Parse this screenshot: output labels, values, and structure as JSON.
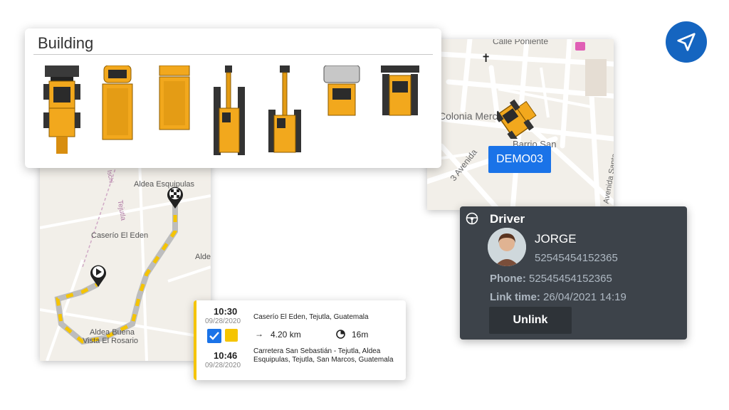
{
  "building_panel": {
    "title": "Building",
    "vehicles": [
      "loader-icon",
      "dump-truck-icon",
      "tipper-truck-icon",
      "excavator-icon",
      "crane-excavator-icon",
      "road-roller-icon",
      "bulldozer-icon"
    ]
  },
  "map_top": {
    "street_top": "Calle Poniente",
    "colonia": "Colonia Merce",
    "street_avenida": "3 Avenida",
    "street_right": "Avenida Santa",
    "area": "Barrio San",
    "vehicle_tag": "DEMO03"
  },
  "map_bottom": {
    "place_1": "Aldea Esquipulas",
    "place_2": "Caserío El Eden",
    "place_3": "Alde",
    "place_4": "Aldea Buena",
    "place_5": "Vista El Rosario",
    "road": "Tejutla",
    "road_2": "Ischi"
  },
  "driver": {
    "header": "Driver",
    "name": "JORGE",
    "id_number": "52545454152365",
    "phone_label": "Phone:",
    "phone": "52545454152365",
    "link_label": "Link time:",
    "link_time": "26/04/2021 14:19",
    "unlink_label": "Unlink"
  },
  "trip": {
    "start_time": "10:30",
    "start_date": "09/28/2020",
    "start_address": "Caserío El Eden, Tejutla, Guatemala",
    "distance": "4.20 km",
    "duration": "16m",
    "end_time": "10:46",
    "end_date": "09/28/2020",
    "end_address": "Carretera San Sebastián - Tejutla, Aldea Esquipulas, Tejutla, San Marcos, Guatemala"
  },
  "colors": {
    "accent_blue": "#1a73e8",
    "nav_blue": "#1565c0",
    "route_yellow": "#f5c400",
    "driver_bg": "#3d434a"
  }
}
